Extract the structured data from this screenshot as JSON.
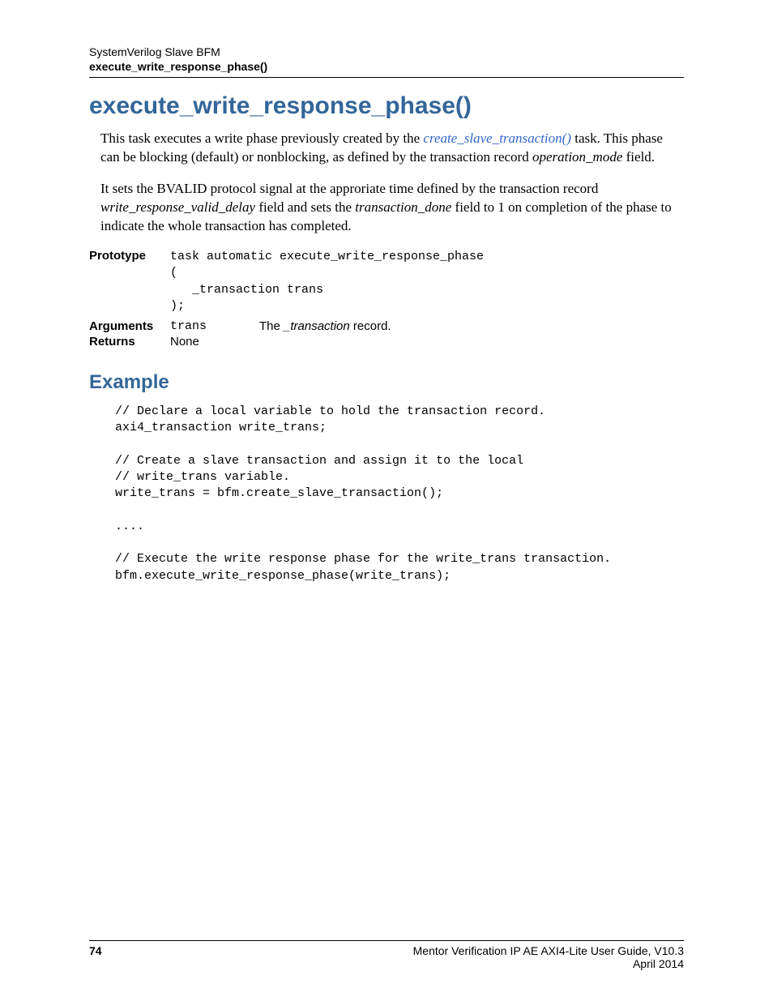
{
  "header": {
    "line1": "SystemVerilog Slave BFM",
    "line2": "execute_write_response_phase()"
  },
  "title": "execute_write_response_phase()",
  "para1": {
    "pre": "This task executes a write phase previously created by the ",
    "link": "create_slave_transaction()",
    "post": " task. This phase can be blocking (default) or nonblocking, as defined by the transaction record ",
    "italic": "operation_mode",
    "tail": " field."
  },
  "para2": {
    "pre": "It sets the BVALID protocol signal at the approriate time defined by the transaction record ",
    "i1": "write_response_valid_delay",
    "mid": " field and sets the ",
    "i2": "transaction_done",
    "post": " field to 1 on completion of the phase to indicate the whole transaction has completed."
  },
  "proto": {
    "label": "Prototype",
    "code": "task automatic execute_write_response_phase\n(\n   _transaction trans\n);"
  },
  "args": {
    "label": "Arguments",
    "name": "trans",
    "desc_pre": "The ",
    "desc_i": "_transaction",
    "desc_post": " record."
  },
  "returns": {
    "label": "Returns",
    "value": "None"
  },
  "example": {
    "heading": "Example",
    "code": "// Declare a local variable to hold the transaction record.\naxi4_transaction write_trans;\n\n// Create a slave transaction and assign it to the local\n// write_trans variable.\nwrite_trans = bfm.create_slave_transaction();\n\n....\n\n// Execute the write response phase for the write_trans transaction.\nbfm.execute_write_response_phase(write_trans);"
  },
  "footer": {
    "page": "74",
    "info": "Mentor Verification IP AE AXI4-Lite User Guide, V10.3",
    "date": "April 2014"
  }
}
